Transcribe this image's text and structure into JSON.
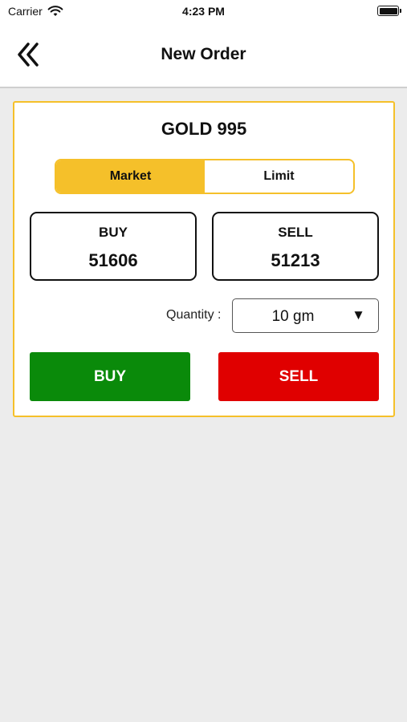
{
  "status_bar": {
    "carrier": "Carrier",
    "time": "4:23 PM"
  },
  "nav": {
    "title": "New Order",
    "back_icon": "double-chevron-left-icon"
  },
  "order": {
    "product": "GOLD 995",
    "order_types": [
      {
        "label": "Market",
        "active": true
      },
      {
        "label": "Limit",
        "active": false
      }
    ],
    "quotes": {
      "buy": {
        "label": "BUY",
        "price": "51606"
      },
      "sell": {
        "label": "SELL",
        "price": "51213"
      }
    },
    "quantity": {
      "label": "Quantity :",
      "value": "10 gm",
      "caret": "▼"
    },
    "actions": {
      "buy_label": "BUY",
      "sell_label": "SELL"
    }
  },
  "colors": {
    "accent": "#f5c02a",
    "buy": "#0a8a0a",
    "sell": "#e00000",
    "background": "#ececec"
  }
}
